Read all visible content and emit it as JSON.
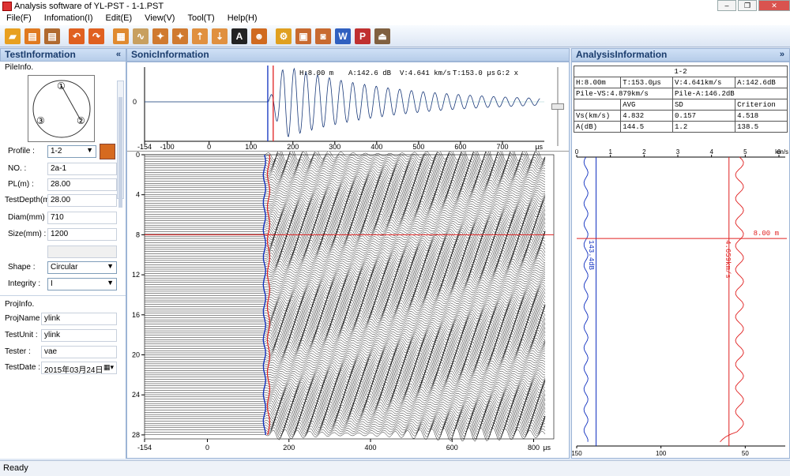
{
  "window": {
    "title": "Analysis software of YL-PST - 1-1.PST"
  },
  "menu": [
    "File(F)",
    "Infomation(I)",
    "Edit(E)",
    "View(V)",
    "Tool(T)",
    "Help(H)"
  ],
  "toolbar": [
    {
      "icon": "folder-open-icon",
      "color": "#e8a020",
      "glyph": "▰"
    },
    {
      "icon": "save-icon",
      "color": "#e07a20",
      "glyph": "▤"
    },
    {
      "icon": "save-as-icon",
      "color": "#b06a30",
      "glyph": "▤"
    },
    {
      "icon": "undo-icon",
      "color": "#e06020",
      "glyph": "↶"
    },
    {
      "icon": "redo-icon",
      "color": "#e06020",
      "glyph": "↷"
    },
    {
      "icon": "layers-icon",
      "color": "#e08a30",
      "glyph": "▦"
    },
    {
      "icon": "waveform-icon",
      "color": "#c8a060",
      "glyph": "∿"
    },
    {
      "icon": "wrench-icon",
      "color": "#d07a30",
      "glyph": "✦"
    },
    {
      "icon": "tools-icon",
      "color": "#d07a30",
      "glyph": "✦"
    },
    {
      "icon": "chart-up-icon",
      "color": "#e09040",
      "glyph": "⇡"
    },
    {
      "icon": "chart-down-icon",
      "color": "#e09040",
      "glyph": "⇣"
    },
    {
      "icon": "auto-icon",
      "color": "#222222",
      "glyph": "A"
    },
    {
      "icon": "person-icon",
      "color": "#d06a20",
      "glyph": "☻"
    },
    {
      "icon": "settings-icon",
      "color": "#e0a020",
      "glyph": "⚙"
    },
    {
      "icon": "print-icon",
      "color": "#c86a30",
      "glyph": "▣"
    },
    {
      "icon": "camera-icon",
      "color": "#c86a30",
      "glyph": "◙"
    },
    {
      "icon": "word-export-icon",
      "color": "#3060c0",
      "glyph": "W"
    },
    {
      "icon": "pdf-export-icon",
      "color": "#c03030",
      "glyph": "P"
    },
    {
      "icon": "exit-icon",
      "color": "#806040",
      "glyph": "⏏"
    }
  ],
  "panes": {
    "left": "TestInformation",
    "mid": "SonicInformation",
    "right": "AnalysisInformation",
    "collapse": "«",
    "collapse_right": "»"
  },
  "pile": {
    "section": "PileInfo.",
    "profile_label": "Profile :",
    "profile": "1-2",
    "no_label": "NO. :",
    "no": "2a-1",
    "pl_label": "PL(m) :",
    "pl": "28.00",
    "depth_label": "TestDepth(m)",
    "depth": "28.00",
    "diam_label": "Diam(mm) :",
    "diam": "710",
    "size_label": "Size(mm) :",
    "size": "1200",
    "shape_label": "Shape :",
    "shape": "Circular",
    "integrity_label": "Integrity :",
    "integrity": "I",
    "tubes": [
      "①",
      "②",
      "③"
    ]
  },
  "proj": {
    "section": "ProjInfo.",
    "name_label": "ProjName :",
    "name": "ylink",
    "unit_label": "TestUnit :",
    "unit": "ylink",
    "tester_label": "Tester :",
    "tester": "vae",
    "date_label": "TestDate :",
    "date": "2015年03月24日"
  },
  "wave": {
    "h": "H:8.00 m",
    "a": "A:142.6 dB",
    "v": "V:4.641 km/s",
    "t": "T:153.0 µs",
    "g": "G:2 x",
    "zero": "0",
    "xticks": [
      -154,
      -100,
      0,
      100,
      200,
      300,
      400,
      500,
      600,
      700
    ],
    "xunit": "µs"
  },
  "scan": {
    "yticks": [
      0,
      4,
      8,
      12,
      16,
      20,
      24,
      28
    ],
    "xticks": [
      -154,
      0,
      200,
      400,
      600,
      800
    ],
    "xunit": "µs"
  },
  "stats": {
    "header": "1-2",
    "h": "H:8.00m",
    "t": "T:153.0µs",
    "v": "V:4.641km/s",
    "a": "A:142.6dB",
    "pile_vs": "Pile-VS:4.879km/s",
    "pile_a": "Pile-A:146.2dB",
    "cols": [
      "",
      "AVG",
      "SD",
      "Criterion"
    ],
    "rows": [
      [
        "Vs(km/s)",
        "4.832",
        "0.157",
        "4.518"
      ],
      [
        "A(dB)",
        "144.5",
        "1.2",
        "138.5"
      ]
    ]
  },
  "profile_plot": {
    "vs_ticks": [
      0,
      1,
      2,
      3,
      4,
      5,
      6
    ],
    "vs_unit": "km/s",
    "a_ticks": [
      150,
      100,
      50
    ],
    "depth_label": "8.00 m",
    "a_marker": "143.4dB",
    "vs_marker": "4.659km/s"
  },
  "status": "Ready",
  "colors": {
    "red": "#e02020",
    "blue": "#1030c0",
    "accent": "#1b3d6d"
  }
}
